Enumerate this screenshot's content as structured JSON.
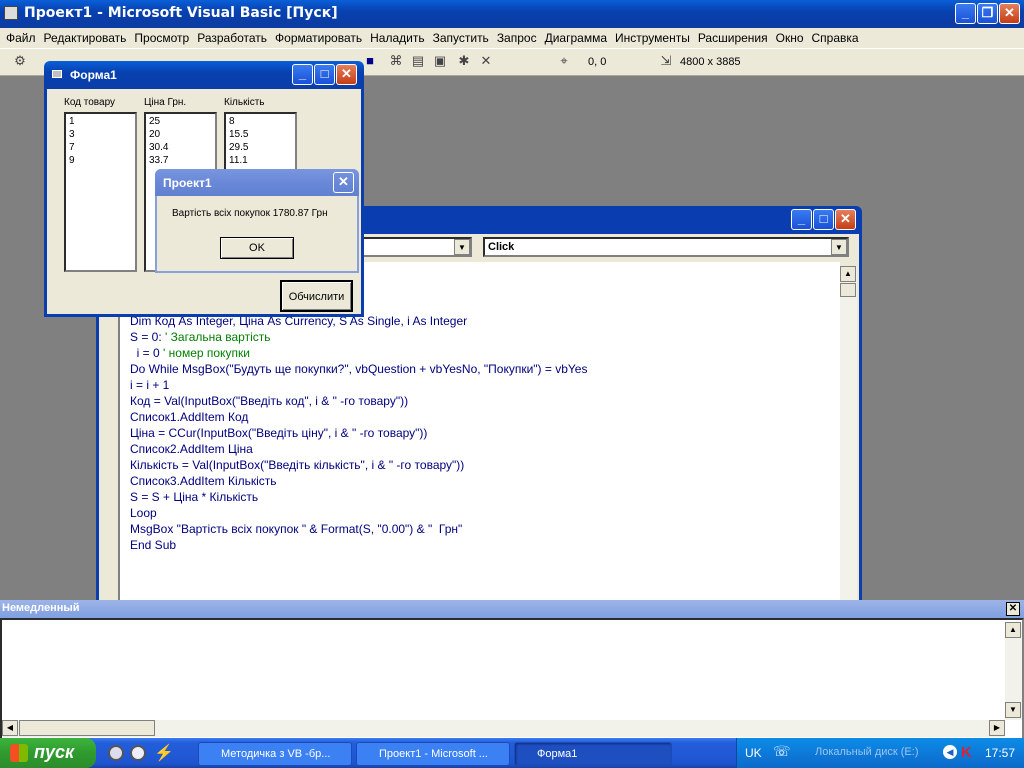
{
  "app": {
    "title": "Проект1 - Microsoft Visual Basic [Пуск]"
  },
  "menu": [
    "Файл",
    "Редактировать",
    "Просмотр",
    "Разработать",
    "Форматировать",
    "Наладить",
    "Запустить",
    "Запрос",
    "Диаграмма",
    "Инструменты",
    "Расширения",
    "Окно",
    "Справка"
  ],
  "toolbar": {
    "position": "0, 0",
    "size": "4800 x 3885"
  },
  "code_window": {
    "proc_combo": "Click",
    "lines": [
      {
        "text": "Dim Код As Integer, Ціна As Currency, S As Single, i As Integer"
      },
      {
        "text": "S = 0: ",
        "comment": "' Загальна вартість"
      },
      {
        "text": "  i = 0 ",
        "comment": "' номер покупки"
      },
      {
        "text": "Do While MsgBox(\"Будуть ще покупки?\", vbQuestion + vbYesNo, \"Покупки\") = vbYes"
      },
      {
        "text": "i = i + 1"
      },
      {
        "text": "Код = Val(InputBox(\"Введіть код\", i & \" -го товару\"))"
      },
      {
        "text": "Список1.AddItem Код"
      },
      {
        "text": "Ціна = CCur(InputBox(\"Введіть ціну\", i & \" -го товару\"))"
      },
      {
        "text": "Список2.AddItem Ціна"
      },
      {
        "text": "Кількість = Val(InputBox(\"Введіть кількість\", i & \" -го товару\"))"
      },
      {
        "text": "Список3.AddItem Кількість"
      },
      {
        "text": "S = S + Ціна * Кількість"
      },
      {
        "text": "Loop"
      },
      {
        "text": "MsgBox \"Вартість всіх покупок \" & Format(S, \"0.00\") & \"  Грн\""
      },
      {
        "text": "End Sub"
      }
    ]
  },
  "form1": {
    "title": "Форма1",
    "col1_label": "Код  товару",
    "col2_label": "Ціна Грн.",
    "col3_label": "Кількість",
    "col1_items": [
      "1",
      "3",
      "7",
      "9"
    ],
    "col2_items": [
      "25",
      "20",
      "30.4",
      "33.7"
    ],
    "col3_items": [
      "8",
      "15.5",
      "29.5",
      "11.1"
    ],
    "compute_button": "Обчислити"
  },
  "msgbox": {
    "title": "Проект1",
    "message": "Вартість всіх покупок 1780.87  Грн",
    "ok": "OK"
  },
  "immediate": {
    "title": "Немедленный"
  },
  "taskbar": {
    "start": "пуск",
    "tasks": [
      "Методичка з VB -бр...",
      "Проект1 - Microsoft ...",
      "Форма1"
    ],
    "lang": "UK",
    "drive": "Локальный диск (E:)",
    "clock": "17:57"
  }
}
